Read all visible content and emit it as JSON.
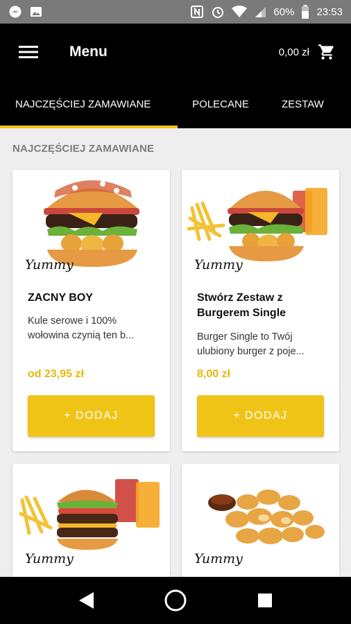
{
  "status_bar": {
    "battery": "60%",
    "time": "23:53",
    "icons": [
      "messenger-icon",
      "gallery-icon",
      "nfc-icon",
      "alarm-icon",
      "wifi-icon",
      "signal-icon",
      "battery-icon"
    ]
  },
  "app_bar": {
    "title": "Menu",
    "cart_total": "0,00 zł",
    "icons": [
      "hamburger-icon",
      "cart-icon"
    ]
  },
  "tabs": [
    {
      "label": "NAJCZĘŚCIEJ ZAMAWIANE",
      "active": true
    },
    {
      "label": "POLECANE",
      "active": false
    },
    {
      "label": "ZESTAW",
      "active": false
    }
  ],
  "section_title": "NAJCZĘŚCIEJ ZAMAWIANE",
  "products": [
    {
      "brand": "Yummy",
      "name": "ZACNY BOY",
      "description": "Kule serowe i 100% wołowina czynią ten b...",
      "price": "od 23,95 zł",
      "button": "+ DODAJ"
    },
    {
      "brand": "Yummy",
      "name": "Stwórz Zestaw z Burgerem Single",
      "description": "Burger Single to Twój ulubiony burger z poje...",
      "price": "8,00 zł",
      "button": "+ DODAJ"
    },
    {
      "brand": "Yummy"
    },
    {
      "brand": "Yummy"
    }
  ],
  "colors": {
    "accent": "#f0c417",
    "price": "#e8b80a",
    "bar": "#000000",
    "background": "#eeeeee"
  },
  "nav_bar": {
    "icons": [
      "back-icon",
      "home-icon",
      "recents-icon"
    ]
  }
}
